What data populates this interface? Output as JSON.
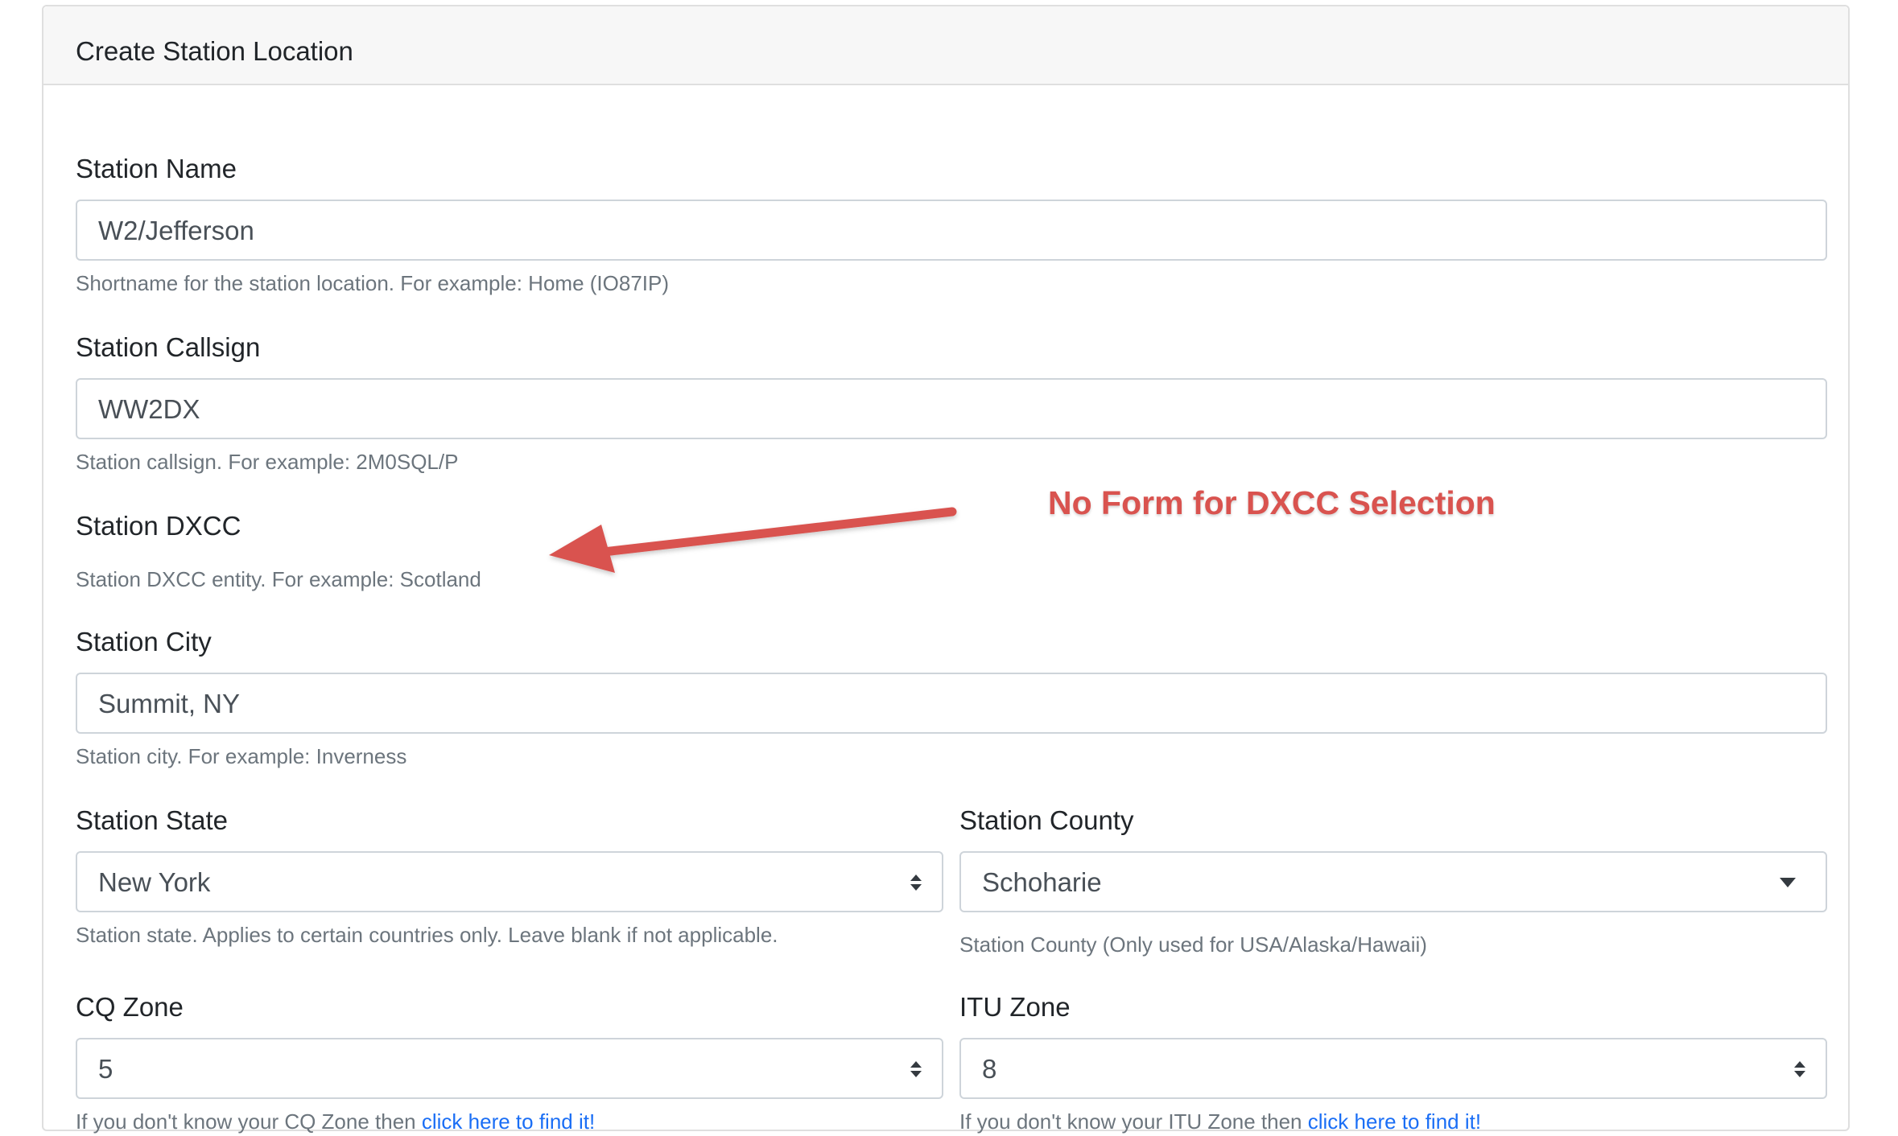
{
  "card": {
    "title": "Create Station Location"
  },
  "station_name": {
    "label": "Station Name",
    "value": "W2/Jefferson",
    "help": "Shortname for the station location. For example: Home (IO87IP)"
  },
  "station_callsign": {
    "label": "Station Callsign",
    "value": "WW2DX",
    "help": "Station callsign. For example: 2M0SQL/P"
  },
  "station_dxcc": {
    "label": "Station DXCC",
    "help": "Station DXCC entity. For example: Scotland"
  },
  "station_city": {
    "label": "Station City",
    "value": "Summit, NY",
    "help": "Station city. For example: Inverness"
  },
  "station_state": {
    "label": "Station State",
    "selected": "New York",
    "help": "Station state. Applies to certain countries only. Leave blank if not applicable."
  },
  "station_county": {
    "label": "Station County",
    "selected": "Schoharie",
    "help": "Station County (Only used for USA/Alaska/Hawaii)"
  },
  "cq_zone": {
    "label": "CQ Zone",
    "selected": "5",
    "help_prefix": "If you don't know your CQ Zone then ",
    "help_link": "click here to find it!"
  },
  "itu_zone": {
    "label": "ITU Zone",
    "selected": "8",
    "help_prefix": "If you don't know your ITU Zone then ",
    "help_link": "click here to find it!"
  },
  "annotation": {
    "text": "No Form for DXCC Selection",
    "color": "#d9534f"
  },
  "colors": {
    "link": "#1a6ef5",
    "help_text": "#6c757d",
    "border": "#ced4da",
    "header_bg": "#f7f7f7"
  },
  "icons": {
    "select_caret": "up-down-caret-icon",
    "dropdown_caret": "chevron-down-icon",
    "annotation_arrow": "arrow-left-icon"
  }
}
